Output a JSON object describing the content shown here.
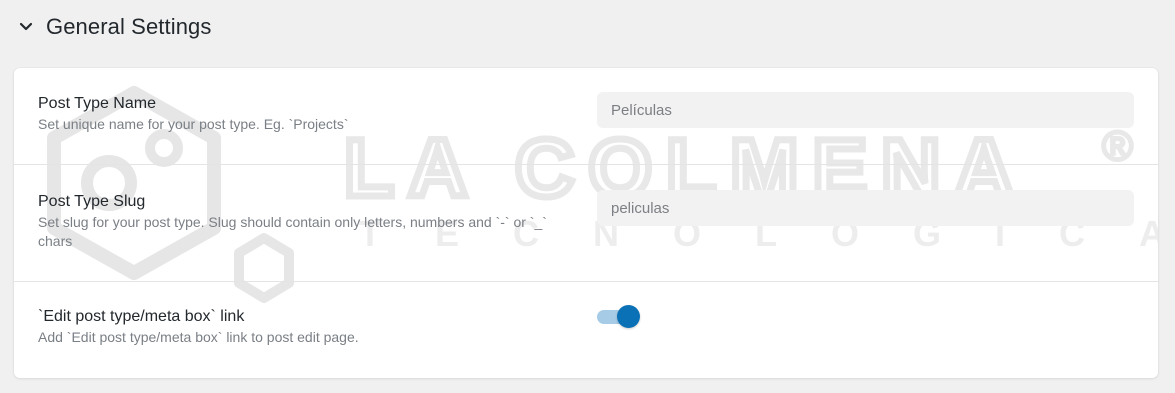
{
  "section": {
    "title": "General Settings",
    "collapse_icon": "chevron-down-icon"
  },
  "fields": {
    "post_type_name": {
      "label": "Post Type Name",
      "description": "Set unique name for your post type. Eg. `Projects`",
      "value": "Películas"
    },
    "post_type_slug": {
      "label": "Post Type Slug",
      "description": "Set slug for your post type. Slug should contain only letters, numbers and `-` or `_` chars",
      "value": "peliculas"
    },
    "edit_link": {
      "label": "`Edit post type/meta box` link",
      "description": "Add `Edit post type/meta box` link to post edit page.",
      "enabled": true
    }
  },
  "watermark": {
    "line1": "LA COLMENA",
    "line2": "TECNOLÓGICA",
    "registered_mark": "®"
  },
  "colors": {
    "accent": "#0a71b6",
    "toggle_track": "#a6cbe6",
    "input_bg": "#f2f2f2",
    "page_bg": "#f0f0f1"
  }
}
